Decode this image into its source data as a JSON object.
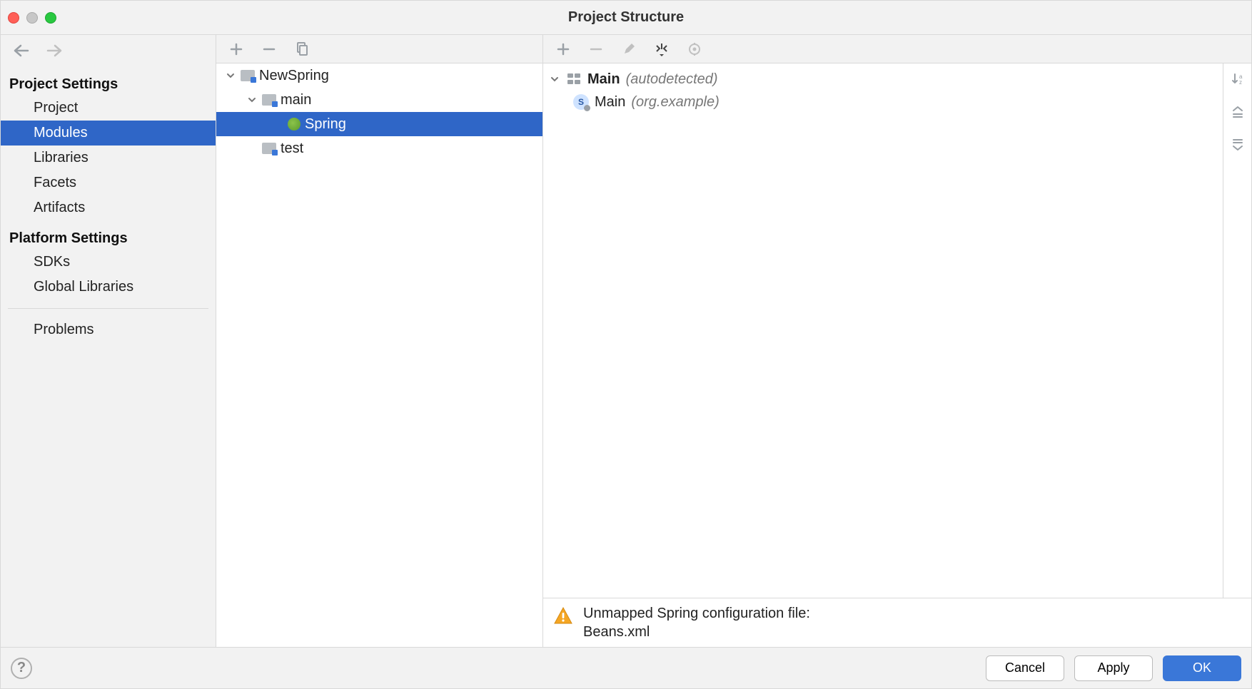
{
  "title": "Project Structure",
  "sidebar": {
    "sections": [
      {
        "title": "Project Settings",
        "items": [
          "Project",
          "Modules",
          "Libraries",
          "Facets",
          "Artifacts"
        ],
        "selected": "Modules"
      },
      {
        "title": "Platform Settings",
        "items": [
          "SDKs",
          "Global Libraries"
        ]
      }
    ],
    "extra": [
      "Problems"
    ]
  },
  "modules_tree": [
    {
      "level": 0,
      "label": "NewSpring",
      "icon": "folder",
      "expanded": true
    },
    {
      "level": 1,
      "label": "main",
      "icon": "folder",
      "expanded": true
    },
    {
      "level": 2,
      "label": "Spring",
      "icon": "spring",
      "selected": true
    },
    {
      "level": 1,
      "label": "test",
      "icon": "folder"
    }
  ],
  "context": {
    "group_name": "Main",
    "group_suffix": "(autodetected)",
    "item_name": "Main",
    "item_suffix": "(org.example)"
  },
  "warning": {
    "line1": "Unmapped Spring configuration file:",
    "line2": "Beans.xml"
  },
  "buttons": {
    "cancel": "Cancel",
    "apply": "Apply",
    "ok": "OK"
  }
}
